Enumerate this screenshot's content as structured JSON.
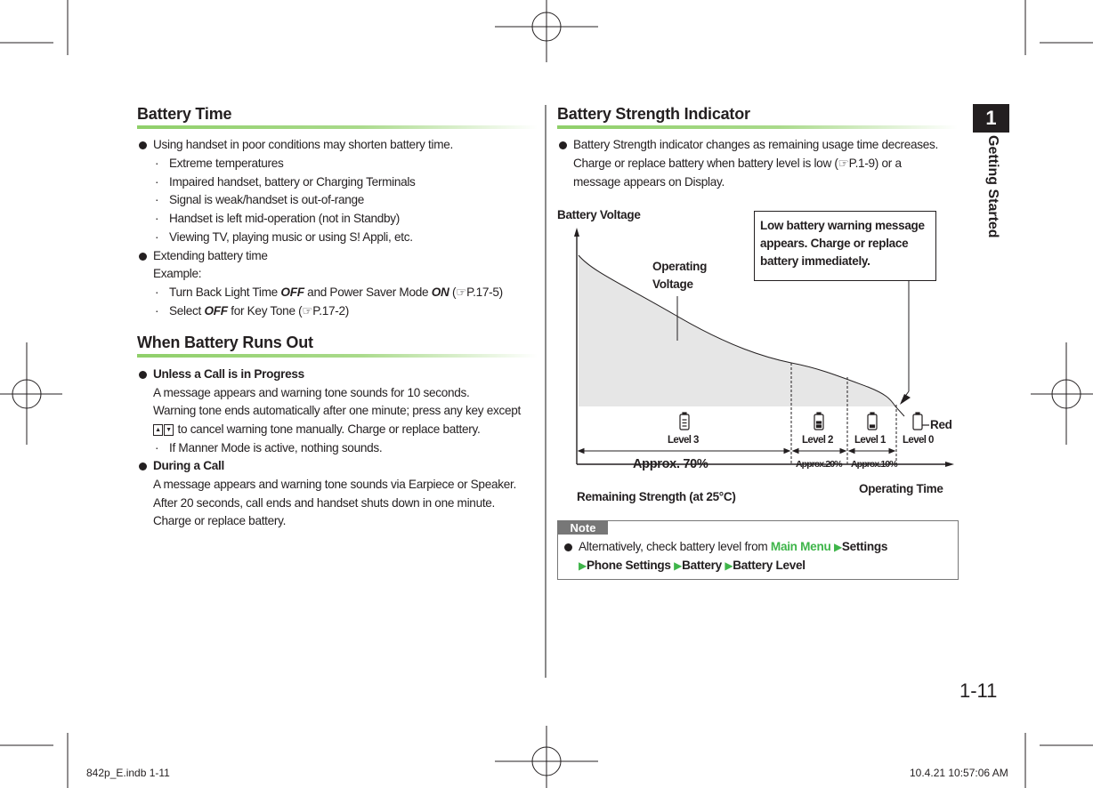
{
  "chapter": {
    "number": "1",
    "title": "Getting Started"
  },
  "page_number": "1-11",
  "footer": {
    "left": "842p_E.indb   1-11",
    "right": "10.4.21   10:57:06 AM"
  },
  "battery_time": {
    "heading": "Battery Time",
    "bullet1": "Using handset in poor conditions may shorten battery time.",
    "sub1": [
      "Extreme temperatures",
      "Impaired handset, battery or Charging Terminals",
      "Signal is weak/handset is out-of-range",
      "Handset is left mid-operation (not in Standby)",
      "Viewing TV, playing music or using S! Appli, etc."
    ],
    "bullet2": "Extending battery time",
    "example": "Example:",
    "ex1": {
      "a": "Turn Back Light Time ",
      "b": "OFF",
      "c": " and Power Saver Mode ",
      "d": "ON",
      "e": " (",
      "f": "P.17-5)"
    },
    "ex2": {
      "a": "Select ",
      "b": "OFF",
      "c": " for Key Tone (",
      "d": "P.17-2)"
    }
  },
  "runs_out": {
    "heading": "When Battery Runs Out",
    "b1_title": "Unless a Call is in Progress",
    "b1_lines": [
      "A message appears and warning tone sounds for 10 seconds.",
      "Warning tone ends automatically after one minute; press any key except"
    ],
    "b1_line3": " to cancel warning tone manually. Charge or replace battery.",
    "b1_sub": "If Manner Mode is active, nothing sounds.",
    "b2_title": "During a Call",
    "b2_lines": [
      "A message appears and warning tone sounds via Earpiece or Speaker.",
      "After 20 seconds, call ends and handset shuts down in one minute.",
      "Charge or replace battery."
    ]
  },
  "indicator": {
    "heading": "Battery Strength Indicator",
    "lines": [
      "Battery Strength indicator changes as remaining usage time decreases.",
      "Charge or replace battery when battery level is low ("
    ],
    "ref": "P.1-9) or a",
    "line3": "message appears on Display."
  },
  "diagram": {
    "y_axis": "Battery Voltage",
    "x_axis": "Operating Time",
    "curve_label": [
      "Operating",
      "Voltage"
    ],
    "warning": "Low battery warning message appears. Charge or replace battery immediately.",
    "levels": [
      {
        "label": "Level 3",
        "share": "Approx. 70%",
        "icon": "battery-full-icon"
      },
      {
        "label": "Level 2",
        "share": "Approx.20%",
        "icon": "battery-two-thirds-icon"
      },
      {
        "label": "Level 1",
        "share": "Approx.10%",
        "icon": "battery-one-third-icon"
      },
      {
        "label": "Level 0",
        "share": "",
        "icon": "battery-empty-icon"
      }
    ],
    "red_label": "Red",
    "remaining_label": "Remaining Strength (at 25°C)"
  },
  "note": {
    "label": "Note",
    "text": "Alternatively, check battery level from ",
    "path": [
      "Main Menu",
      "Settings",
      "Phone Settings",
      "Battery",
      "Battery Level"
    ]
  },
  "colors": {
    "accent_green": "#3fb54a",
    "rule_green": "#8fcf6a",
    "fill_gray": "#e6e6e6"
  }
}
